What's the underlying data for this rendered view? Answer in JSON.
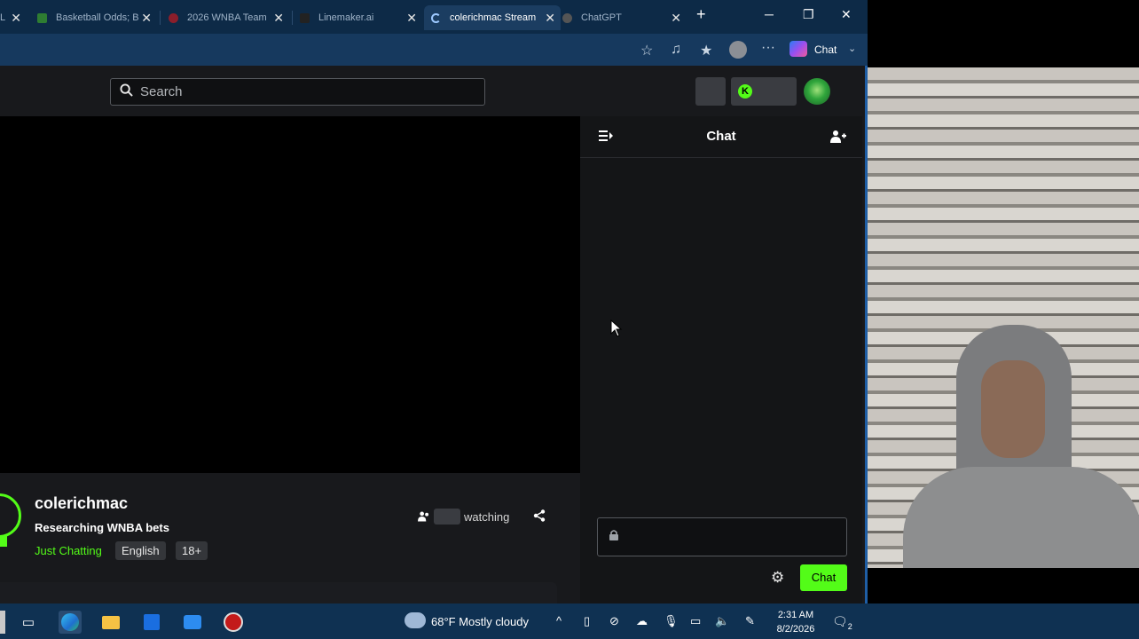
{
  "browser": {
    "tabs": [
      {
        "label": "L",
        "favicon_color": "#3a3a3a",
        "active": false
      },
      {
        "label": "Basketball Odds; B",
        "favicon_color": "#2e7d32",
        "active": false
      },
      {
        "label": "2026 WNBA Team",
        "favicon_color": "#8b1e2b",
        "active": false
      },
      {
        "label": "Linemaker.ai",
        "favicon_color": "#222222",
        "active": false
      },
      {
        "label": "colerichmac Stream",
        "favicon_color": "#1e88e5",
        "active": true
      },
      {
        "label": "ChatGPT",
        "favicon_color": "#555555",
        "active": false
      }
    ],
    "new_tab": "+",
    "window_controls": {
      "minimize": "─",
      "restore": "❐",
      "close": "✕"
    },
    "toolbar": {
      "copilot_label": "Chat"
    }
  },
  "header": {
    "search_placeholder": "Search"
  },
  "chat": {
    "title": "Chat",
    "send_label": "Chat"
  },
  "stream": {
    "streamer": "colerichmac",
    "title": "Researching WNBA bets",
    "category": "Just Chatting",
    "tags": [
      "English",
      "18+"
    ],
    "watching_label": "watching"
  },
  "taskbar": {
    "weather": "68°F  Mostly cloudy",
    "time": "2:31 AM",
    "date": "8/2/2026",
    "notifications": "2"
  },
  "colors": {
    "accent": "#53fc18",
    "tab_bar": "#0d2a47",
    "taskbar": "#0f3152"
  }
}
